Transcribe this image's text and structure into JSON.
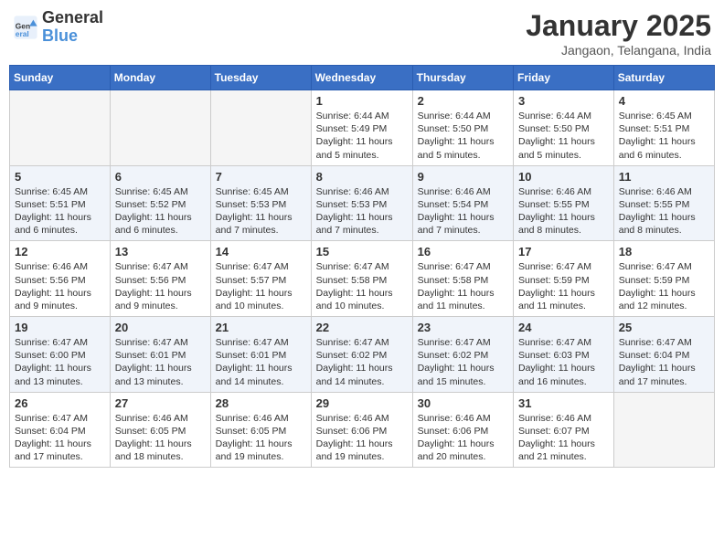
{
  "header": {
    "logo_line1": "General",
    "logo_line2": "Blue",
    "month": "January 2025",
    "location": "Jangaon, Telangana, India"
  },
  "weekdays": [
    "Sunday",
    "Monday",
    "Tuesday",
    "Wednesday",
    "Thursday",
    "Friday",
    "Saturday"
  ],
  "weeks": [
    [
      {
        "day": "",
        "empty": true
      },
      {
        "day": "",
        "empty": true
      },
      {
        "day": "",
        "empty": true
      },
      {
        "day": "1",
        "sunrise": "6:44 AM",
        "sunset": "5:49 PM",
        "daylight": "11 hours and 5 minutes."
      },
      {
        "day": "2",
        "sunrise": "6:44 AM",
        "sunset": "5:50 PM",
        "daylight": "11 hours and 5 minutes."
      },
      {
        "day": "3",
        "sunrise": "6:44 AM",
        "sunset": "5:50 PM",
        "daylight": "11 hours and 5 minutes."
      },
      {
        "day": "4",
        "sunrise": "6:45 AM",
        "sunset": "5:51 PM",
        "daylight": "11 hours and 6 minutes."
      }
    ],
    [
      {
        "day": "5",
        "sunrise": "6:45 AM",
        "sunset": "5:51 PM",
        "daylight": "11 hours and 6 minutes."
      },
      {
        "day": "6",
        "sunrise": "6:45 AM",
        "sunset": "5:52 PM",
        "daylight": "11 hours and 6 minutes."
      },
      {
        "day": "7",
        "sunrise": "6:45 AM",
        "sunset": "5:53 PM",
        "daylight": "11 hours and 7 minutes."
      },
      {
        "day": "8",
        "sunrise": "6:46 AM",
        "sunset": "5:53 PM",
        "daylight": "11 hours and 7 minutes."
      },
      {
        "day": "9",
        "sunrise": "6:46 AM",
        "sunset": "5:54 PM",
        "daylight": "11 hours and 7 minutes."
      },
      {
        "day": "10",
        "sunrise": "6:46 AM",
        "sunset": "5:55 PM",
        "daylight": "11 hours and 8 minutes."
      },
      {
        "day": "11",
        "sunrise": "6:46 AM",
        "sunset": "5:55 PM",
        "daylight": "11 hours and 8 minutes."
      }
    ],
    [
      {
        "day": "12",
        "sunrise": "6:46 AM",
        "sunset": "5:56 PM",
        "daylight": "11 hours and 9 minutes."
      },
      {
        "day": "13",
        "sunrise": "6:47 AM",
        "sunset": "5:56 PM",
        "daylight": "11 hours and 9 minutes."
      },
      {
        "day": "14",
        "sunrise": "6:47 AM",
        "sunset": "5:57 PM",
        "daylight": "11 hours and 10 minutes."
      },
      {
        "day": "15",
        "sunrise": "6:47 AM",
        "sunset": "5:58 PM",
        "daylight": "11 hours and 10 minutes."
      },
      {
        "day": "16",
        "sunrise": "6:47 AM",
        "sunset": "5:58 PM",
        "daylight": "11 hours and 11 minutes."
      },
      {
        "day": "17",
        "sunrise": "6:47 AM",
        "sunset": "5:59 PM",
        "daylight": "11 hours and 11 minutes."
      },
      {
        "day": "18",
        "sunrise": "6:47 AM",
        "sunset": "5:59 PM",
        "daylight": "11 hours and 12 minutes."
      }
    ],
    [
      {
        "day": "19",
        "sunrise": "6:47 AM",
        "sunset": "6:00 PM",
        "daylight": "11 hours and 13 minutes."
      },
      {
        "day": "20",
        "sunrise": "6:47 AM",
        "sunset": "6:01 PM",
        "daylight": "11 hours and 13 minutes."
      },
      {
        "day": "21",
        "sunrise": "6:47 AM",
        "sunset": "6:01 PM",
        "daylight": "11 hours and 14 minutes."
      },
      {
        "day": "22",
        "sunrise": "6:47 AM",
        "sunset": "6:02 PM",
        "daylight": "11 hours and 14 minutes."
      },
      {
        "day": "23",
        "sunrise": "6:47 AM",
        "sunset": "6:02 PM",
        "daylight": "11 hours and 15 minutes."
      },
      {
        "day": "24",
        "sunrise": "6:47 AM",
        "sunset": "6:03 PM",
        "daylight": "11 hours and 16 minutes."
      },
      {
        "day": "25",
        "sunrise": "6:47 AM",
        "sunset": "6:04 PM",
        "daylight": "11 hours and 17 minutes."
      }
    ],
    [
      {
        "day": "26",
        "sunrise": "6:47 AM",
        "sunset": "6:04 PM",
        "daylight": "11 hours and 17 minutes."
      },
      {
        "day": "27",
        "sunrise": "6:46 AM",
        "sunset": "6:05 PM",
        "daylight": "11 hours and 18 minutes."
      },
      {
        "day": "28",
        "sunrise": "6:46 AM",
        "sunset": "6:05 PM",
        "daylight": "11 hours and 19 minutes."
      },
      {
        "day": "29",
        "sunrise": "6:46 AM",
        "sunset": "6:06 PM",
        "daylight": "11 hours and 19 minutes."
      },
      {
        "day": "30",
        "sunrise": "6:46 AM",
        "sunset": "6:06 PM",
        "daylight": "11 hours and 20 minutes."
      },
      {
        "day": "31",
        "sunrise": "6:46 AM",
        "sunset": "6:07 PM",
        "daylight": "11 hours and 21 minutes."
      },
      {
        "day": "",
        "empty": true
      }
    ]
  ]
}
